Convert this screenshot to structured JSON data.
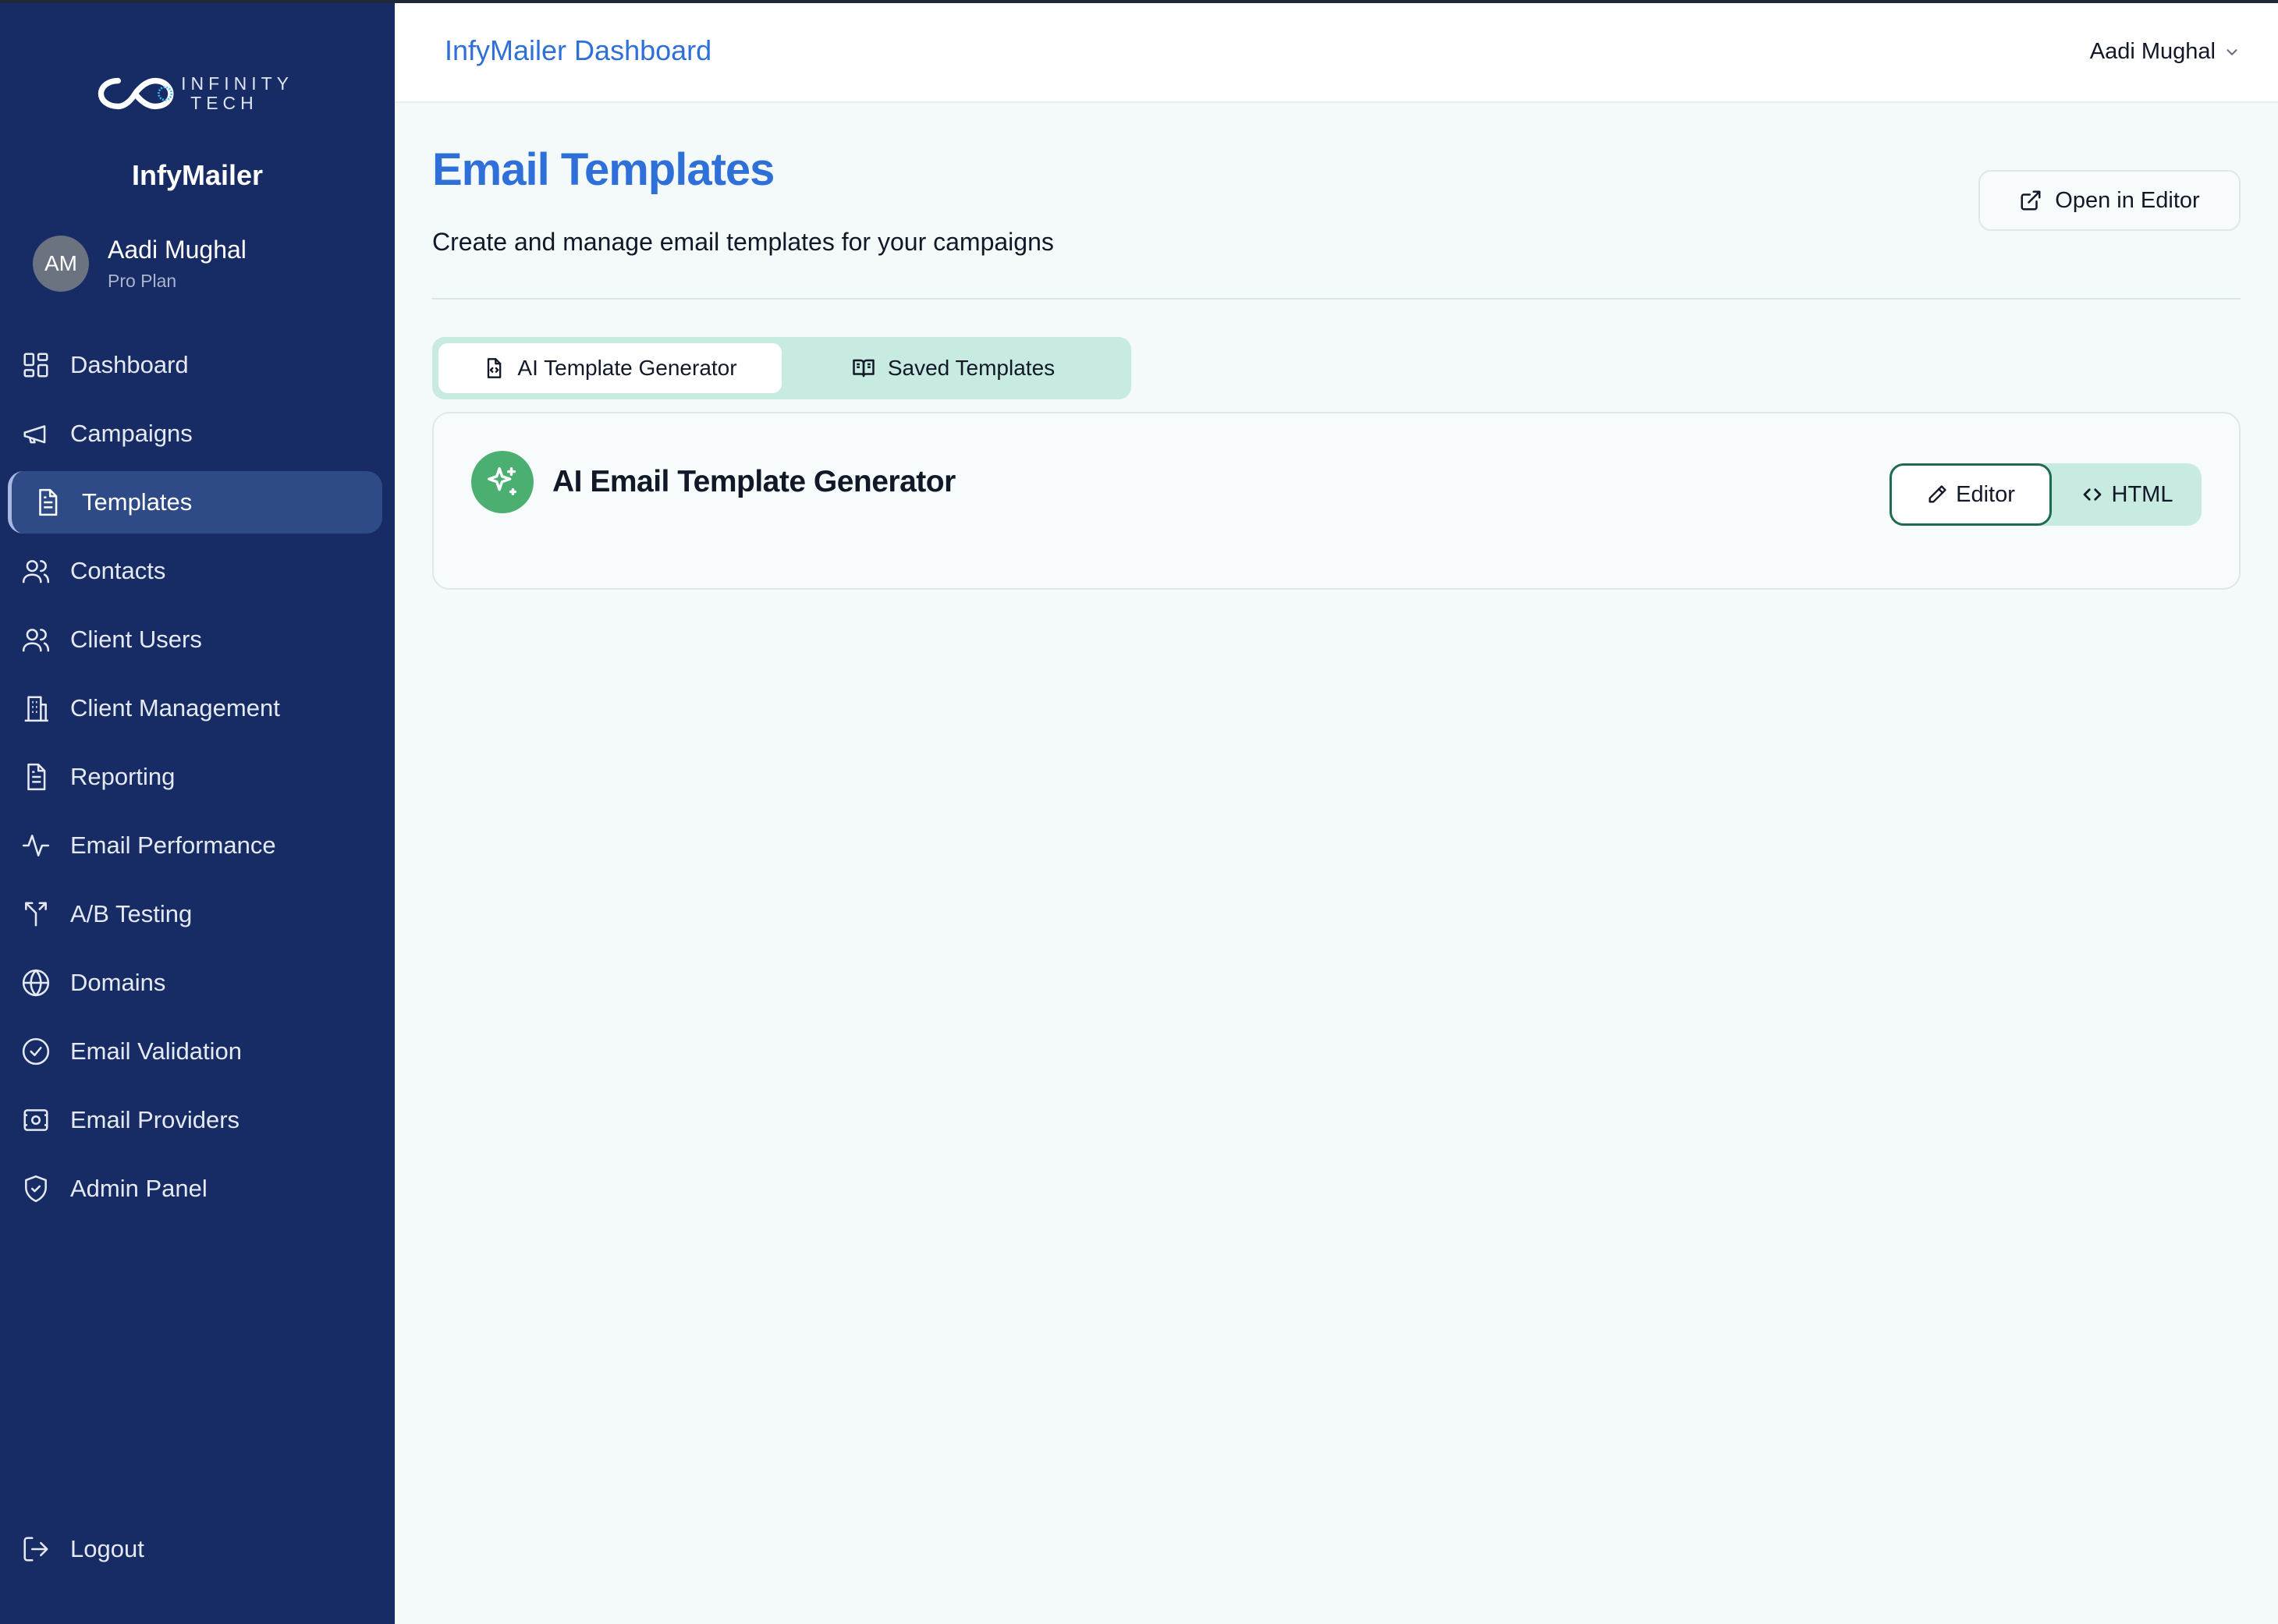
{
  "brand": {
    "logo_line1": "INFINITY",
    "logo_line2": "TECH",
    "app_name": "InfyMailer"
  },
  "user": {
    "initials": "AM",
    "name": "Aadi Mughal",
    "plan": "Pro Plan"
  },
  "sidebar": {
    "items": [
      {
        "label": "Dashboard",
        "icon": "dashboard-grid-icon",
        "active": false
      },
      {
        "label": "Campaigns",
        "icon": "megaphone-icon",
        "active": false
      },
      {
        "label": "Templates",
        "icon": "document-icon",
        "active": true
      },
      {
        "label": "Contacts",
        "icon": "users-icon",
        "active": false
      },
      {
        "label": "Client Users",
        "icon": "users-icon",
        "active": false
      },
      {
        "label": "Client Management",
        "icon": "building-icon",
        "active": false
      },
      {
        "label": "Reporting",
        "icon": "report-document-icon",
        "active": false
      },
      {
        "label": "Email Performance",
        "icon": "activity-icon",
        "active": false
      },
      {
        "label": "A/B Testing",
        "icon": "split-icon",
        "active": false
      },
      {
        "label": "Domains",
        "icon": "globe-icon",
        "active": false
      },
      {
        "label": "Email Validation",
        "icon": "check-circle-icon",
        "active": false
      },
      {
        "label": "Email Providers",
        "icon": "server-cog-icon",
        "active": false
      },
      {
        "label": "Admin Panel",
        "icon": "shield-check-icon",
        "active": false
      }
    ],
    "logout_label": "Logout"
  },
  "header": {
    "title": "InfyMailer Dashboard",
    "user_name": "Aadi Mughal"
  },
  "main": {
    "title": "Email Templates",
    "subtitle": "Create and manage email templates for your campaigns",
    "open_editor_label": "Open in Editor",
    "tabs": [
      {
        "label": "AI Template Generator",
        "active": true
      },
      {
        "label": "Saved Templates",
        "active": false
      }
    ],
    "card": {
      "title": "AI Email Template Generator",
      "modes": [
        {
          "label": "Editor",
          "active": true
        },
        {
          "label": "HTML",
          "active": false
        }
      ]
    }
  },
  "colors": {
    "sidebar_bg": "#172b64",
    "accent_blue": "#2f6fd8",
    "mint": "#c7ebe0",
    "green": "#4caf72",
    "page_bg": "#f4f9f9"
  }
}
